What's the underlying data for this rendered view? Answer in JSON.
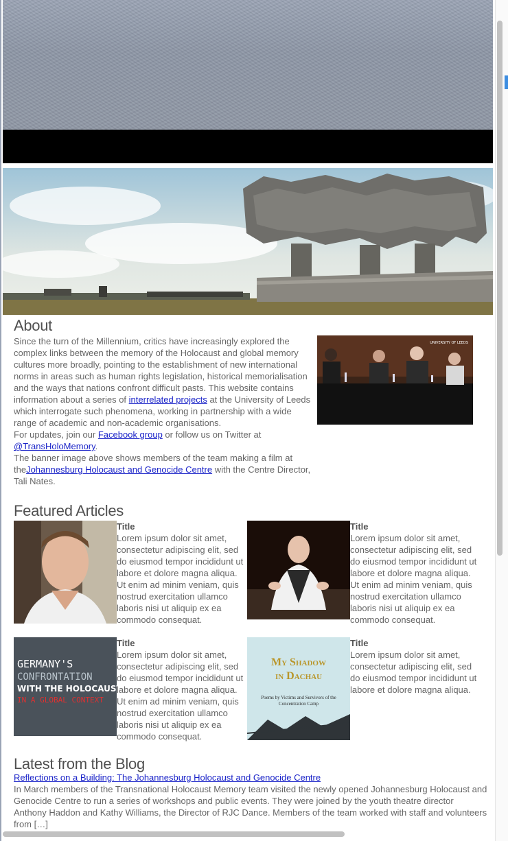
{
  "about": {
    "heading": "About",
    "p1_before": "Since the turn of the Millennium, critics have increasingly explored the complex  links between the memory of the Holocaust and global memory cultures more broadly, pointing to the establishment of new international norms in areas such as human rights legislation, historical memorialisation and the ways that nations confront difficult pasts.  This website contains information about a  series of ",
    "p1_link": "interrelated projects",
    "p1_after": " at the University of Leeds which interrogate such phenomena, working in partnership with a wide range of academic and non-academic organisations.",
    "p2_before": "For updates, join our ",
    "p2_link1": "Facebook group",
    "p2_mid": " or follow us on Twitter at ",
    "p2_link2": "@TransHoloMemory",
    "p2_after": ".",
    "p3_before": "The banner image above shows members of the team making a film at the",
    "p3_link": "Johannesburg Holocaust and Genocide Centre",
    "p3_after": " with the Centre Director, Tali Nates.",
    "image_caption": "UNIVERSITY OF LEEDS"
  },
  "featured": {
    "heading": "Featured Articles",
    "items": [
      {
        "title": "Title",
        "body": "Lorem ipsum dolor sit amet, consectetur adipiscing elit, sed do eiusmod tempor incididunt ut labore et dolore magna aliqua. Ut enim ad minim veniam, quis nostrud exercitation ullamco laboris nisi ut aliquip ex ea commodo consequat."
      },
      {
        "title": "Title",
        "body": "Lorem ipsum dolor sit amet, consectetur adipiscing elit, sed do eiusmod tempor incididunt ut labore et dolore magna aliqua. Ut enim ad minim veniam, quis nostrud exercitation ullamco laboris nisi ut aliquip ex ea commodo consequat."
      },
      {
        "title": "Title",
        "body": "Lorem ipsum dolor sit amet, consectetur adipiscing elit, sed do eiusmod tempor incididunt ut labore et dolore magna aliqua. Ut enim ad minim veniam, quis nostrud exercitation ullamco laboris nisi ut aliquip ex ea commodo consequat.",
        "cover_line1": "GERMANY'S",
        "cover_line2": "CONFRONTATION",
        "cover_line3": "WITH THE HOLOCAUST",
        "cover_line4": "IN A GLOBAL CONTEXT"
      },
      {
        "title": "Title",
        "body": "Lorem ipsum dolor sit amet, consectetur adipiscing elit, sed do eiusmod tempor incididunt ut labore et dolore magna aliqua.",
        "cover_line1": "My Shadow",
        "cover_line2": "in Dachau",
        "cover_line3": "Poems by Victims and Survivors of the Concentration Camp"
      }
    ]
  },
  "blog": {
    "heading": "Latest from the Blog",
    "post_title": "Reflections on a Building: The Johannesburg Holocaust and Genocide Centre",
    "excerpt": "In March members of the Transnational Holocaust Memory team visited the newly opened Johannesburg Holocaust and Genocide Centre to run a series of workshops and public events. They were joined by the youth theatre director Anthony Haddon and Kathy Williams, the Director of RJC Dance. Members of the team worked with staff and volunteers from […]"
  },
  "colors": {
    "link": "#1a23c8",
    "text": "#666666",
    "heading": "#505050"
  }
}
